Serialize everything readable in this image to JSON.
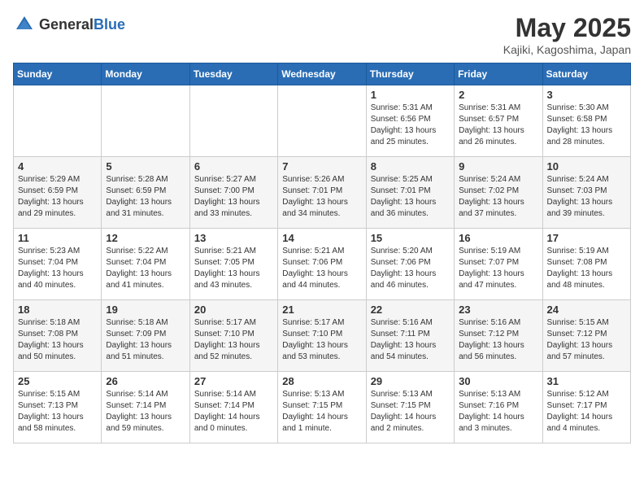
{
  "header": {
    "logo_general": "General",
    "logo_blue": "Blue",
    "title": "May 2025",
    "location": "Kajiki, Kagoshima, Japan"
  },
  "weekdays": [
    "Sunday",
    "Monday",
    "Tuesday",
    "Wednesday",
    "Thursday",
    "Friday",
    "Saturday"
  ],
  "weeks": [
    [
      {
        "day": "",
        "info": ""
      },
      {
        "day": "",
        "info": ""
      },
      {
        "day": "",
        "info": ""
      },
      {
        "day": "",
        "info": ""
      },
      {
        "day": "1",
        "info": "Sunrise: 5:31 AM\nSunset: 6:56 PM\nDaylight: 13 hours\nand 25 minutes."
      },
      {
        "day": "2",
        "info": "Sunrise: 5:31 AM\nSunset: 6:57 PM\nDaylight: 13 hours\nand 26 minutes."
      },
      {
        "day": "3",
        "info": "Sunrise: 5:30 AM\nSunset: 6:58 PM\nDaylight: 13 hours\nand 28 minutes."
      }
    ],
    [
      {
        "day": "4",
        "info": "Sunrise: 5:29 AM\nSunset: 6:59 PM\nDaylight: 13 hours\nand 29 minutes."
      },
      {
        "day": "5",
        "info": "Sunrise: 5:28 AM\nSunset: 6:59 PM\nDaylight: 13 hours\nand 31 minutes."
      },
      {
        "day": "6",
        "info": "Sunrise: 5:27 AM\nSunset: 7:00 PM\nDaylight: 13 hours\nand 33 minutes."
      },
      {
        "day": "7",
        "info": "Sunrise: 5:26 AM\nSunset: 7:01 PM\nDaylight: 13 hours\nand 34 minutes."
      },
      {
        "day": "8",
        "info": "Sunrise: 5:25 AM\nSunset: 7:01 PM\nDaylight: 13 hours\nand 36 minutes."
      },
      {
        "day": "9",
        "info": "Sunrise: 5:24 AM\nSunset: 7:02 PM\nDaylight: 13 hours\nand 37 minutes."
      },
      {
        "day": "10",
        "info": "Sunrise: 5:24 AM\nSunset: 7:03 PM\nDaylight: 13 hours\nand 39 minutes."
      }
    ],
    [
      {
        "day": "11",
        "info": "Sunrise: 5:23 AM\nSunset: 7:04 PM\nDaylight: 13 hours\nand 40 minutes."
      },
      {
        "day": "12",
        "info": "Sunrise: 5:22 AM\nSunset: 7:04 PM\nDaylight: 13 hours\nand 41 minutes."
      },
      {
        "day": "13",
        "info": "Sunrise: 5:21 AM\nSunset: 7:05 PM\nDaylight: 13 hours\nand 43 minutes."
      },
      {
        "day": "14",
        "info": "Sunrise: 5:21 AM\nSunset: 7:06 PM\nDaylight: 13 hours\nand 44 minutes."
      },
      {
        "day": "15",
        "info": "Sunrise: 5:20 AM\nSunset: 7:06 PM\nDaylight: 13 hours\nand 46 minutes."
      },
      {
        "day": "16",
        "info": "Sunrise: 5:19 AM\nSunset: 7:07 PM\nDaylight: 13 hours\nand 47 minutes."
      },
      {
        "day": "17",
        "info": "Sunrise: 5:19 AM\nSunset: 7:08 PM\nDaylight: 13 hours\nand 48 minutes."
      }
    ],
    [
      {
        "day": "18",
        "info": "Sunrise: 5:18 AM\nSunset: 7:08 PM\nDaylight: 13 hours\nand 50 minutes."
      },
      {
        "day": "19",
        "info": "Sunrise: 5:18 AM\nSunset: 7:09 PM\nDaylight: 13 hours\nand 51 minutes."
      },
      {
        "day": "20",
        "info": "Sunrise: 5:17 AM\nSunset: 7:10 PM\nDaylight: 13 hours\nand 52 minutes."
      },
      {
        "day": "21",
        "info": "Sunrise: 5:17 AM\nSunset: 7:10 PM\nDaylight: 13 hours\nand 53 minutes."
      },
      {
        "day": "22",
        "info": "Sunrise: 5:16 AM\nSunset: 7:11 PM\nDaylight: 13 hours\nand 54 minutes."
      },
      {
        "day": "23",
        "info": "Sunrise: 5:16 AM\nSunset: 7:12 PM\nDaylight: 13 hours\nand 56 minutes."
      },
      {
        "day": "24",
        "info": "Sunrise: 5:15 AM\nSunset: 7:12 PM\nDaylight: 13 hours\nand 57 minutes."
      }
    ],
    [
      {
        "day": "25",
        "info": "Sunrise: 5:15 AM\nSunset: 7:13 PM\nDaylight: 13 hours\nand 58 minutes."
      },
      {
        "day": "26",
        "info": "Sunrise: 5:14 AM\nSunset: 7:14 PM\nDaylight: 13 hours\nand 59 minutes."
      },
      {
        "day": "27",
        "info": "Sunrise: 5:14 AM\nSunset: 7:14 PM\nDaylight: 14 hours\nand 0 minutes."
      },
      {
        "day": "28",
        "info": "Sunrise: 5:13 AM\nSunset: 7:15 PM\nDaylight: 14 hours\nand 1 minute."
      },
      {
        "day": "29",
        "info": "Sunrise: 5:13 AM\nSunset: 7:15 PM\nDaylight: 14 hours\nand 2 minutes."
      },
      {
        "day": "30",
        "info": "Sunrise: 5:13 AM\nSunset: 7:16 PM\nDaylight: 14 hours\nand 3 minutes."
      },
      {
        "day": "31",
        "info": "Sunrise: 5:12 AM\nSunset: 7:17 PM\nDaylight: 14 hours\nand 4 minutes."
      }
    ]
  ]
}
